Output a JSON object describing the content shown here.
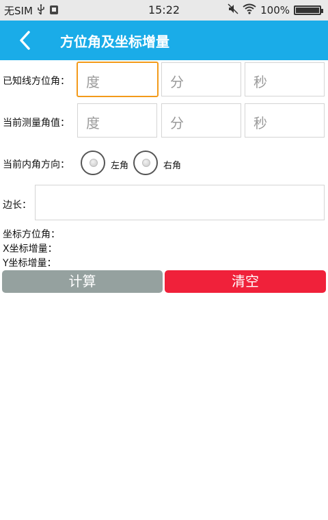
{
  "status_bar": {
    "carrier": "无SIM",
    "time": "15:22",
    "battery": "100%",
    "icons": [
      "usb-icon",
      "debug-icon",
      "mute-icon",
      "wifi-icon",
      "battery-icon"
    ]
  },
  "app_bar": {
    "title": "方位角及坐标增量",
    "back_icon": "chevron-left-icon",
    "color": "#1aace8"
  },
  "known_azimuth": {
    "label": "已知线方位角：",
    "degree_placeholder": "度",
    "minute_placeholder": "分",
    "second_placeholder": "秒"
  },
  "measured_angle": {
    "label": "当前测量角值：",
    "degree_placeholder": "度",
    "minute_placeholder": "分",
    "second_placeholder": "秒"
  },
  "inner_angle_direction": {
    "label": "当前内角方向：",
    "left_option": "左角",
    "right_option": "右角"
  },
  "side_length": {
    "label": "边长：",
    "value": ""
  },
  "results": {
    "azimuth_label": "坐标方位角：",
    "x_label": "X坐标增量：",
    "y_label": "Y坐标增量："
  },
  "buttons": {
    "calculate": "计算",
    "clear": "清空",
    "calculate_color": "#95a19f",
    "clear_color": "#f0213a"
  }
}
